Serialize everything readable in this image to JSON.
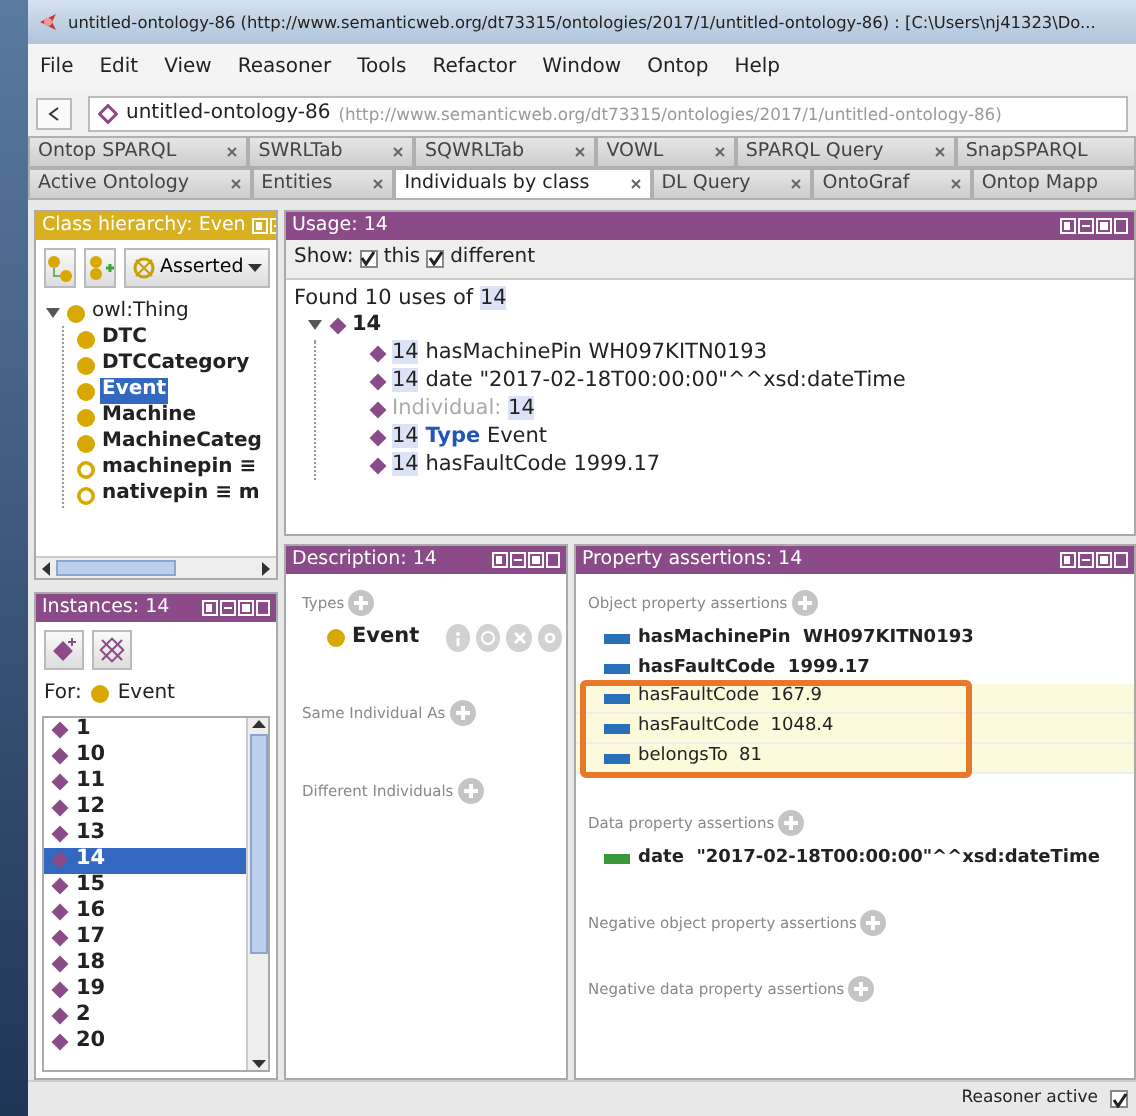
{
  "window": {
    "title": "untitled-ontology-86 (http://www.semanticweb.org/dt73315/ontologies/2017/1/untitled-ontology-86)  : [C:\\Users\\nj41323\\Do..."
  },
  "menu": [
    "File",
    "Edit",
    "View",
    "Reasoner",
    "Tools",
    "Refactor",
    "Window",
    "Ontop",
    "Help"
  ],
  "address": {
    "name": "untitled-ontology-86",
    "iri": "(http://www.semanticweb.org/dt73315/ontologies/2017/1/untitled-ontology-86)"
  },
  "tab_rows": [
    [
      {
        "label": "Ontop SPARQL",
        "selected": false
      },
      {
        "label": "SWRLTab",
        "selected": false
      },
      {
        "label": "SQWRLTab",
        "selected": false
      },
      {
        "label": "VOWL",
        "selected": false
      },
      {
        "label": "SPARQL Query",
        "selected": false
      },
      {
        "label": "SnapSPARQL",
        "selected": false
      }
    ],
    [
      {
        "label": "Active Ontology",
        "selected": false
      },
      {
        "label": "Entities",
        "selected": false
      },
      {
        "label": "Individuals by class",
        "selected": true
      },
      {
        "label": "DL Query",
        "selected": false
      },
      {
        "label": "OntoGraf",
        "selected": false
      },
      {
        "label": "Ontop Mapp",
        "selected": false
      }
    ]
  ],
  "class_hierarchy": {
    "title": "Class hierarchy: Even",
    "mode": "Asserted",
    "tree": [
      {
        "label": "owl:Thing",
        "kind": "class",
        "selected": false,
        "expanded": true,
        "children": [
          {
            "label": "DTC",
            "kind": "class",
            "selected": false
          },
          {
            "label": "DTCCategory",
            "kind": "class",
            "selected": false
          },
          {
            "label": "Event",
            "kind": "class",
            "selected": true
          },
          {
            "label": "Machine",
            "kind": "class",
            "selected": false
          },
          {
            "label": "MachineCateg",
            "kind": "class",
            "selected": false
          },
          {
            "label": "machinepin ≡",
            "kind": "defined",
            "selected": false
          },
          {
            "label": "nativepin ≡ m",
            "kind": "defined",
            "selected": false
          }
        ]
      }
    ]
  },
  "usage": {
    "title": "Usage: 14",
    "show_label": "Show:",
    "filters": [
      {
        "label": "this",
        "checked": true
      },
      {
        "label": "different",
        "checked": true
      }
    ],
    "found_text": "Found 10 uses of",
    "found_entity": "14",
    "root": {
      "label": "14",
      "expanded": true
    },
    "entries": [
      {
        "kind": "assertion",
        "subject": "14",
        "text": "hasMachinePin WH097KITN0193"
      },
      {
        "kind": "assertion",
        "subject": "14",
        "text": "date \"2017-02-18T00:00:00\"^^xsd:dateTime"
      },
      {
        "kind": "header",
        "label": "Individual:",
        "subject": "14"
      },
      {
        "kind": "type",
        "subject": "14",
        "keyword": "Type",
        "text": "Event"
      },
      {
        "kind": "assertion",
        "subject": "14",
        "text": "hasFaultCode 1999.17"
      }
    ]
  },
  "instances": {
    "title": "Instances: 14",
    "for_label": "For:",
    "for_class": "Event",
    "items": [
      {
        "label": "1",
        "selected": false
      },
      {
        "label": "10",
        "selected": false
      },
      {
        "label": "11",
        "selected": false
      },
      {
        "label": "12",
        "selected": false
      },
      {
        "label": "13",
        "selected": false
      },
      {
        "label": "14",
        "selected": true
      },
      {
        "label": "15",
        "selected": false
      },
      {
        "label": "16",
        "selected": false
      },
      {
        "label": "17",
        "selected": false
      },
      {
        "label": "18",
        "selected": false
      },
      {
        "label": "19",
        "selected": false
      },
      {
        "label": "2",
        "selected": false
      },
      {
        "label": "20",
        "selected": false
      }
    ]
  },
  "description": {
    "title": "Description: 14",
    "sections": [
      {
        "label": "Types",
        "entries": [
          "Event"
        ]
      },
      {
        "label": "Same Individual As"
      },
      {
        "label": "Different Individuals"
      }
    ]
  },
  "property_assertions": {
    "title": "Property assertions: 14",
    "sections": [
      {
        "label": "Object property assertions",
        "kind": "object",
        "entries": [
          {
            "property": "hasMachinePin",
            "value": "WH097KITN0193",
            "inferred": false
          },
          {
            "property": "hasFaultCode",
            "value": "1999.17",
            "inferred": false
          },
          {
            "property": "hasFaultCode",
            "value": "167.9",
            "inferred": true
          },
          {
            "property": "hasFaultCode",
            "value": "1048.4",
            "inferred": true
          },
          {
            "property": "belongsTo",
            "value": "81",
            "inferred": true
          }
        ]
      },
      {
        "label": "Data property assertions",
        "kind": "data",
        "entries": [
          {
            "property": "date",
            "value": "\"2017-02-18T00:00:00\"^^xsd:dateTime",
            "inferred": false
          }
        ]
      },
      {
        "label": "Negative object property assertions"
      },
      {
        "label": "Negative data property assertions"
      }
    ]
  },
  "status_bar": {
    "label": "Reasoner active",
    "checked": true
  }
}
